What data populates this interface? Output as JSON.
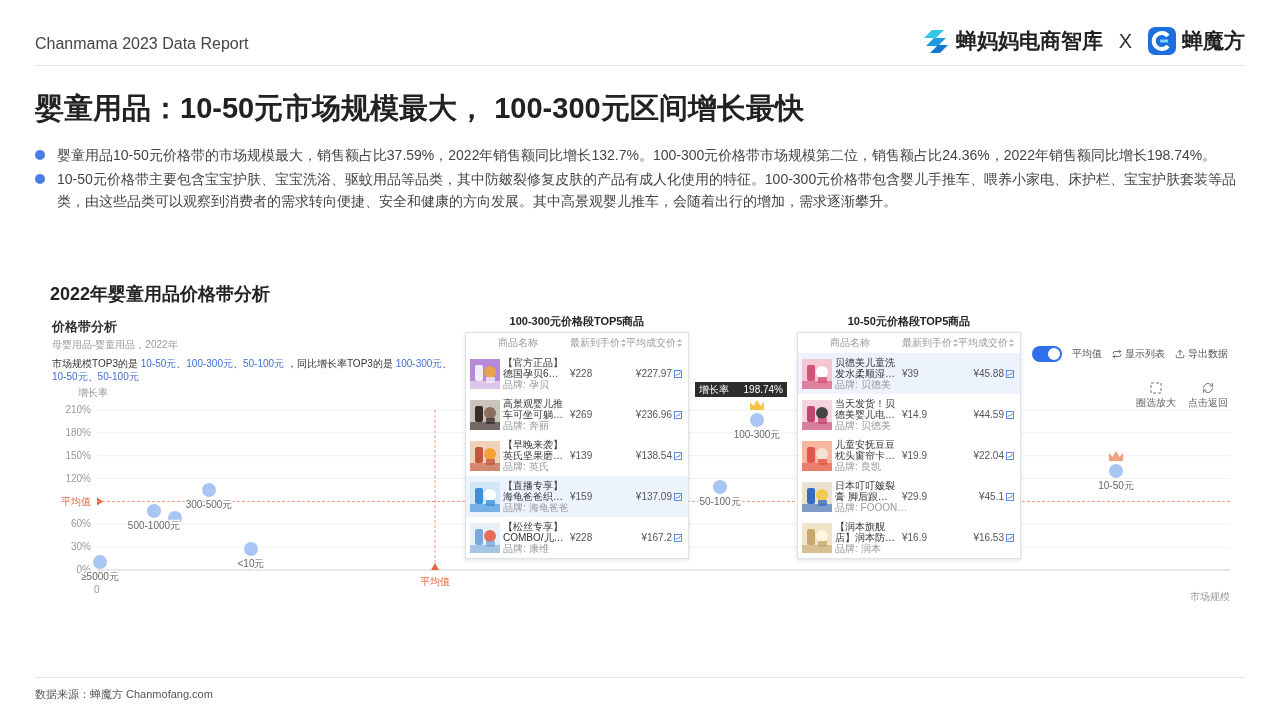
{
  "header": {
    "report_title": "Chanmama 2023 Data Report",
    "brand_1": "蝉妈妈电商智库",
    "separator": "X",
    "brand_2": "蝉魔方"
  },
  "title": "婴童用品：10-50元市场规模最大， 100-300元区间增长最快",
  "bullets": [
    "婴童用品10-50元价格带的市场规模最大，销售额占比37.59%，2022年销售额同比增长132.7%。100-300元价格带市场规模第二位，销售额占比24.36%，2022年销售额同比增长198.74%。",
    "10-50元价格带主要包含宝宝护肤、宝宝洗浴、驱蚊用品等品类，其中防皴裂修复皮肤的产品有成人化使用的特征。100-300元价格带包含婴儿手推车、喂养小家电、床护栏、宝宝护肤套装等品类，由这些品类可以观察到消费者的需求转向便捷、安全和健康的方向发展。其中高景观婴儿推车，会随着出行的增加，需求逐渐攀升。"
  ],
  "section_title": "2022年婴童用品价格带分析",
  "panel": {
    "title": "价格带分析",
    "subtitle": "母婴用品-婴童用品，2022年",
    "summary": [
      {
        "text": "市场规模TOP3的是 ",
        "highlight": false
      },
      {
        "text": "10-50元",
        "highlight": true
      },
      {
        "text": "、",
        "highlight": false
      },
      {
        "text": "100-300元",
        "highlight": true
      },
      {
        "text": "、",
        "highlight": false
      },
      {
        "text": "50-100元",
        "highlight": true
      },
      {
        "text": " ，同比增长率TOP3的是 ",
        "highlight": false
      },
      {
        "text": "100-300元",
        "highlight": true
      },
      {
        "text": "、",
        "highlight": false
      },
      {
        "text": "10-50元",
        "highlight": true
      },
      {
        "text": "、",
        "highlight": false
      },
      {
        "text": "50-100元",
        "highlight": true
      }
    ]
  },
  "toolbar": {
    "average_toggle": {
      "label": "平均值",
      "on": true
    },
    "buttons": [
      {
        "label": "显示列表",
        "kind": "list"
      },
      {
        "label": "导出数据",
        "kind": "export"
      }
    ]
  },
  "zoom_tools": [
    {
      "label": "圈选放大",
      "kind": "select"
    },
    {
      "label": "点击返回",
      "kind": "reset"
    }
  ],
  "chart": {
    "y_title": "增长率",
    "x_title": "市场规模",
    "origin_label": "0",
    "x_average_label": "平均值",
    "y_labels": [
      {
        "text": "210%",
        "kind": "tick"
      },
      {
        "text": "180%",
        "kind": "tick"
      },
      {
        "text": "150%",
        "kind": "tick"
      },
      {
        "text": "120%",
        "kind": "tick"
      },
      {
        "text": "平均值",
        "kind": "average"
      },
      {
        "text": "60%",
        "kind": "tick"
      },
      {
        "text": "30%",
        "kind": "tick"
      },
      {
        "text": "0%",
        "kind": "axis"
      }
    ],
    "points": [
      {
        "label": "≥5000元",
        "crown": false
      },
      {
        "label": "500-1000元",
        "crown": false
      },
      {
        "crown": false
      },
      {
        "label": "300-500元",
        "crown": false
      },
      {
        "label": "<10元",
        "crown": false
      },
      {
        "label": "50-100元",
        "crown": false
      },
      {
        "label": "100-300元",
        "crown": true,
        "tooltip": {
          "label": "增长率",
          "value": "198.74%"
        }
      },
      {
        "label": "10-50元",
        "crown": true
      }
    ]
  },
  "tables": [
    {
      "title": "100-300元价格段TOP5商品",
      "columns": [
        "商品名称",
        "最新到手价",
        "平均成交价"
      ],
      "rows": [
        {
          "name": "【官方正品】德国孕贝6…",
          "brand": "品牌: 孕贝",
          "price": "¥228",
          "avg_price": "¥227.97",
          "highlighted": false
        },
        {
          "name": "高景观婴儿推车可坐可躺…",
          "brand": "品牌: 奔丽",
          "price": "¥269",
          "avg_price": "¥236.96",
          "highlighted": false
        },
        {
          "name": "【早晚来袭】英氏坚果磨…",
          "brand": "品牌: 英氏",
          "price": "¥139",
          "avg_price": "¥138.54",
          "highlighted": false
        },
        {
          "name": "【直播专享】海龟爸爸织…",
          "brand": "品牌: 海龟爸爸",
          "price": "¥159",
          "avg_price": "¥137.09",
          "highlighted": true
        },
        {
          "name": "【松丝专享】COMBO/儿…",
          "brand": "品牌: 康维",
          "price": "¥228",
          "avg_price": "¥167.2",
          "highlighted": false
        }
      ]
    },
    {
      "title": "10-50元价格段TOP5商品",
      "columns": [
        "商品名称",
        "最新到手价",
        "平均成交价"
      ],
      "rows": [
        {
          "name": "贝德美儿童洗发水柔顺湿…",
          "brand": "品牌: 贝德美",
          "price": "¥39",
          "avg_price": "¥45.88",
          "highlighted": true
        },
        {
          "name": "当天发货！贝德美婴儿电…",
          "brand": "品牌: 贝德美",
          "price": "¥14.9",
          "avg_price": "¥44.59",
          "highlighted": false
        },
        {
          "name": "儿童安抚豆豆枕头窗帘卡…",
          "brand": "品牌: 良凯",
          "price": "¥19.9",
          "avg_price": "¥22.04",
          "highlighted": false
        },
        {
          "name": "日本叮叮皴裂膏 脚后跟…",
          "brand": "品牌: FOOON…",
          "price": "¥29.9",
          "avg_price": "¥45.1",
          "highlighted": false
        },
        {
          "name": "【润本旗舰店】润本防…",
          "brand": "品牌: 润本",
          "price": "¥16.9",
          "avg_price": "¥16.53",
          "highlighted": false
        }
      ]
    }
  ],
  "footer": "数据来源：蝉魔方 Chanmofang.com"
}
